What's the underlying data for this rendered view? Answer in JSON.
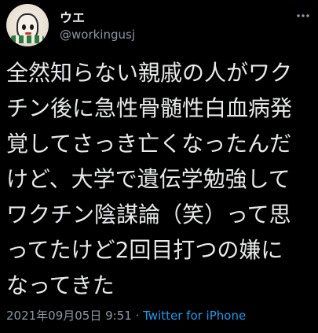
{
  "author": {
    "display_name": "ウエ",
    "handle": "@workingusj"
  },
  "tweet": {
    "text": "全然知らない親戚の人がワク\nチン後に急性骨髄性白血病発\n覚してさっき亡くなったんだ\nけど、大学で遺伝学勉強して\nワクチン陰謀論（笑）って思\nってたけど2回目打つの嫌に\nなってきた"
  },
  "meta": {
    "timestamp": "2021年09月05日 9:51",
    "separator": " · ",
    "source": "Twitter for iPhone"
  },
  "icons": {
    "more": "more-dots-icon",
    "avatar": "character-avatar"
  },
  "colors": {
    "background": "#000000",
    "primary_text": "#e7e9ea",
    "secondary_text": "#8b98a5",
    "link": "#1d9bf0"
  }
}
